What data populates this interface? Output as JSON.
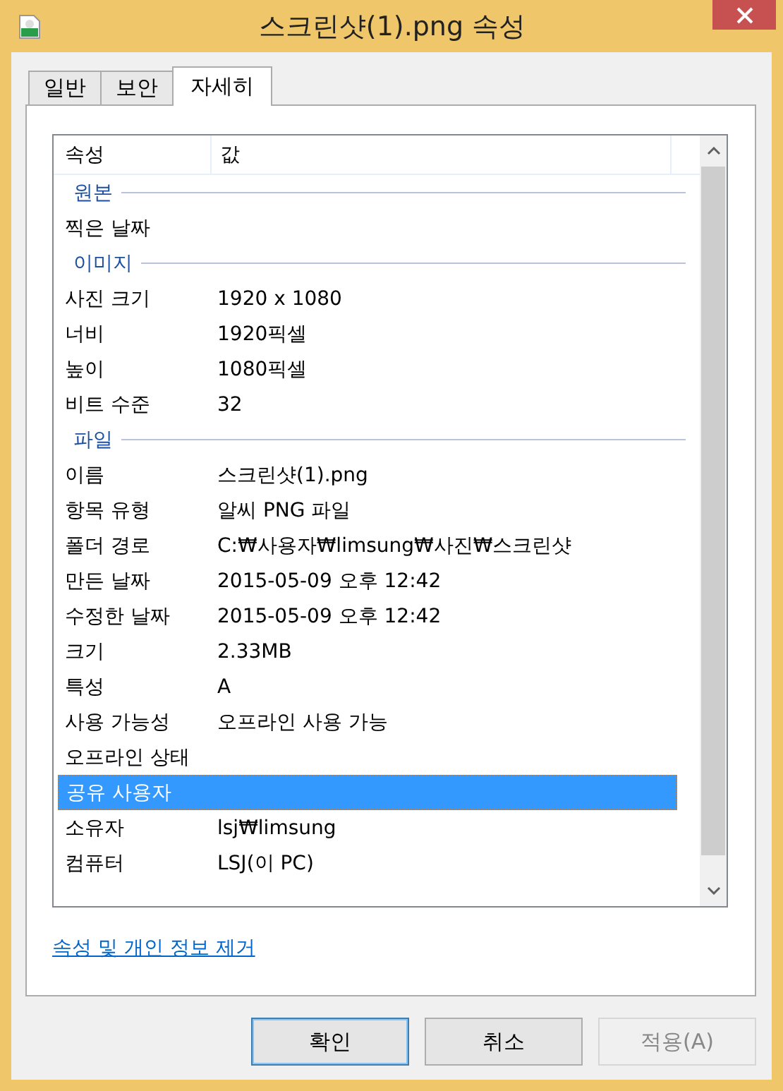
{
  "window": {
    "title": "스크린샷(1).png 속성"
  },
  "tabs": [
    {
      "label": "일반",
      "selected": false
    },
    {
      "label": "보안",
      "selected": false
    },
    {
      "label": "자세히",
      "selected": true
    }
  ],
  "table": {
    "columns": [
      "속성",
      "값"
    ],
    "rows": [
      {
        "kind": "group",
        "label": "원본"
      },
      {
        "kind": "prop",
        "name": "찍은 날짜",
        "value": "",
        "selected": false
      },
      {
        "kind": "group",
        "label": "이미지"
      },
      {
        "kind": "prop",
        "name": "사진 크기",
        "value": "1920 x 1080",
        "selected": false
      },
      {
        "kind": "prop",
        "name": "너비",
        "value": "1920픽셀",
        "selected": false
      },
      {
        "kind": "prop",
        "name": "높이",
        "value": "1080픽셀",
        "selected": false
      },
      {
        "kind": "prop",
        "name": "비트 수준",
        "value": "32",
        "selected": false
      },
      {
        "kind": "group",
        "label": "파일"
      },
      {
        "kind": "prop",
        "name": "이름",
        "value": "스크린샷(1).png",
        "selected": false
      },
      {
        "kind": "prop",
        "name": "항목 유형",
        "value": "알씨 PNG 파일",
        "selected": false
      },
      {
        "kind": "prop",
        "name": "폴더 경로",
        "value": "C:₩사용자₩limsung₩사진₩스크린샷",
        "selected": false
      },
      {
        "kind": "prop",
        "name": "만든 날짜",
        "value": "2015-05-09 오후 12:42",
        "selected": false
      },
      {
        "kind": "prop",
        "name": "수정한 날짜",
        "value": "2015-05-09 오후 12:42",
        "selected": false
      },
      {
        "kind": "prop",
        "name": "크기",
        "value": "2.33MB",
        "selected": false
      },
      {
        "kind": "prop",
        "name": "특성",
        "value": "A",
        "selected": false
      },
      {
        "kind": "prop",
        "name": "사용 가능성",
        "value": "오프라인 사용 가능",
        "selected": false
      },
      {
        "kind": "prop",
        "name": "오프라인 상태",
        "value": "",
        "selected": false
      },
      {
        "kind": "prop",
        "name": "공유 사용자",
        "value": "",
        "selected": true
      },
      {
        "kind": "prop",
        "name": "소유자",
        "value": "lsj₩limsung",
        "selected": false
      },
      {
        "kind": "prop",
        "name": "컴퓨터",
        "value": "LSJ(이 PC)",
        "selected": false
      }
    ]
  },
  "link": "속성 및 개인 정보 제거",
  "buttons": [
    {
      "label": "확인",
      "disabled": false,
      "default": true
    },
    {
      "label": "취소",
      "disabled": false,
      "default": false
    },
    {
      "label": "적용(A)",
      "disabled": true,
      "default": false
    }
  ]
}
